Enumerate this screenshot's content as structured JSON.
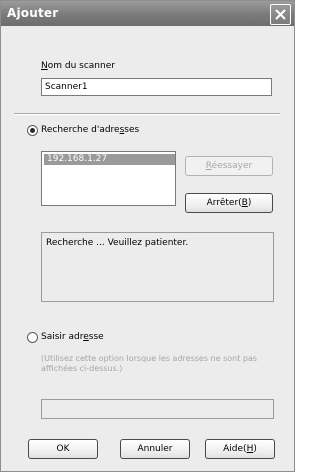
{
  "window": {
    "title": "Ajouter"
  },
  "scanner_name": {
    "label_u": "N",
    "label_rest": "om du scanner",
    "value": "Scanner1"
  },
  "search": {
    "radio_label_pre": "Recherche d'adre",
    "radio_label_u": "s",
    "radio_label_post": "ses",
    "selected": true,
    "addresses": [
      "192.168.1.27"
    ],
    "retry_pre": "",
    "retry_u": "R",
    "retry_post": "éessayer",
    "stop_pre": "Arrêter(",
    "stop_u": "B",
    "stop_post": ")",
    "status_text": "Recherche ... Veuillez patienter."
  },
  "manual": {
    "radio_label_pre": "Saisir adr",
    "radio_label_u": "e",
    "radio_label_post": "sse",
    "selected": false,
    "hint": "(Utilisez cette option lorsque les adresses ne sont pas affichées ci-dessus.)",
    "value": ""
  },
  "buttons": {
    "ok": "OK",
    "cancel": "Annuler",
    "help_pre": "Aide(",
    "help_u": "H",
    "help_post": ")"
  }
}
